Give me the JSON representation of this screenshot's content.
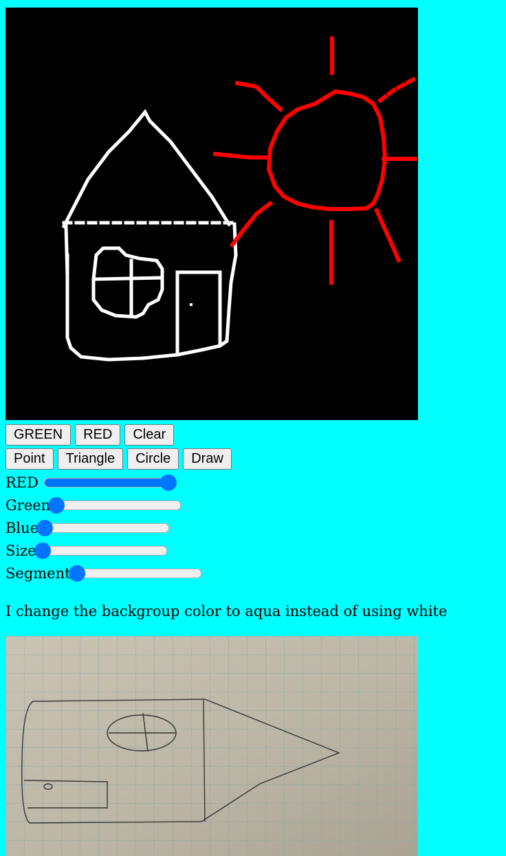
{
  "canvas": {
    "background": "#000000",
    "house_color": "#ffffff",
    "sun_color": "#ff0000"
  },
  "buttons_row1": {
    "green": "GREEN",
    "red": "RED",
    "clear": "Clear"
  },
  "buttons_row2": {
    "point": "Point",
    "triangle": "Triangle",
    "circle": "Circle",
    "draw": "Draw"
  },
  "sliders": [
    {
      "label": "RED",
      "value": 1.0
    },
    {
      "label": "Green",
      "value": 0.0
    },
    {
      "label": "Blue",
      "value": 0.0
    },
    {
      "label": "Size",
      "value": 0.0
    },
    {
      "label": "Segment",
      "value": 0.0
    }
  ],
  "note": "I change the backgroup color to aqua instead of using white",
  "page_background": "#00ffff"
}
